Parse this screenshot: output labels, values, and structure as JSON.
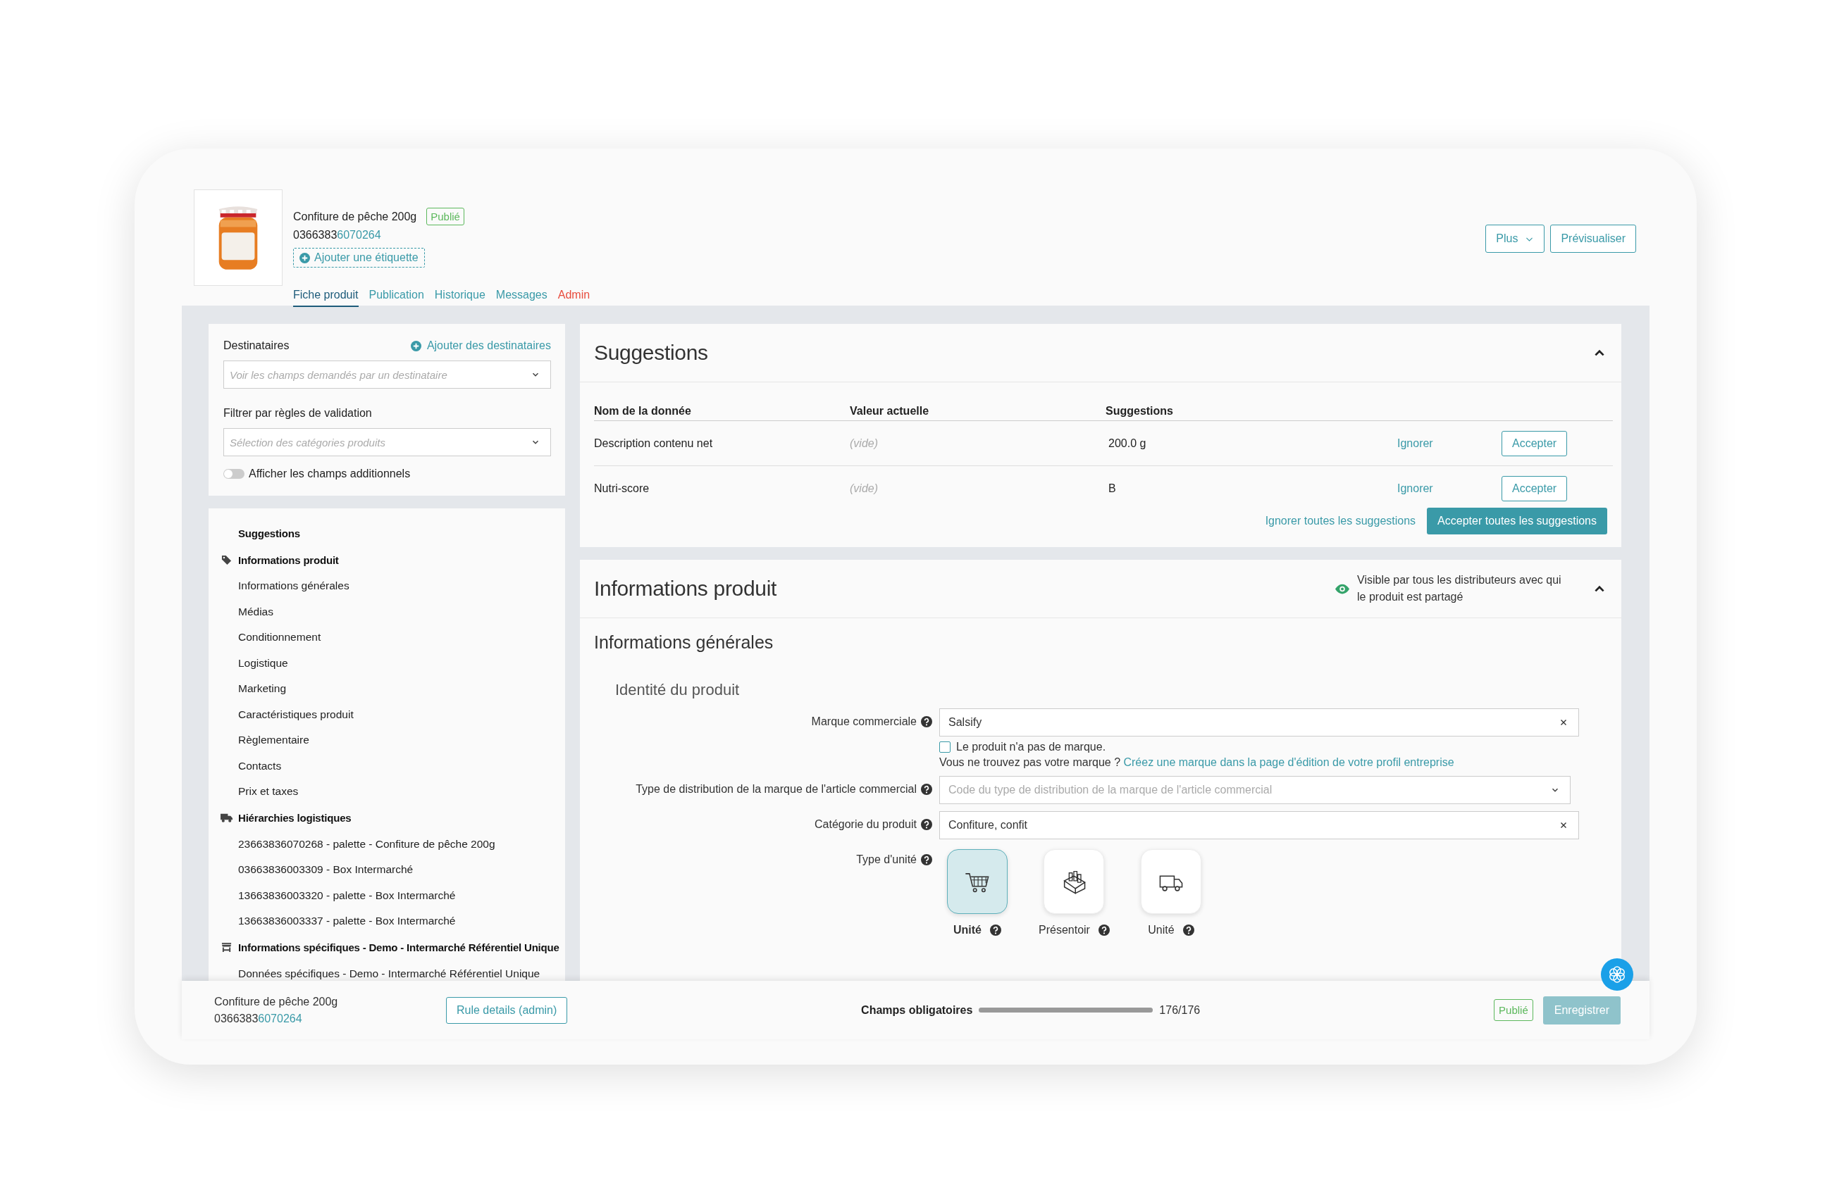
{
  "product": {
    "name": "Confiture de pêche 200g",
    "status": "Publié",
    "code_start": "0366383",
    "code_end": "6070264",
    "add_label": "Ajouter une étiquette"
  },
  "header_buttons": [
    {
      "label": "Plus",
      "kind": "dropdown"
    },
    {
      "label": "Prévisualiser",
      "kind": "plain"
    }
  ],
  "tabs": [
    {
      "label": "Fiche produit",
      "selected": true,
      "kind": "normal"
    },
    {
      "label": "Publication",
      "selected": false,
      "kind": "normal"
    },
    {
      "label": "Historique",
      "selected": false,
      "kind": "normal"
    },
    {
      "label": "Messages",
      "selected": false,
      "kind": "normal"
    },
    {
      "label": "Admin",
      "selected": false,
      "kind": "admin"
    }
  ],
  "filters": {
    "recipients_label": "Destinataires",
    "add_recipients": "Ajouter des destinataires",
    "recipients_placeholder": "Voir les champs demandés par un destinataire",
    "rules_label": "Filtrer par règles de validation",
    "rules_placeholder": "Sélection des catégories produits",
    "toggle": {
      "label": "Afficher les champs additionnels",
      "on": false
    }
  },
  "nav": [
    {
      "label": "Suggestions",
      "kind": "link"
    },
    {
      "label": "Informations produit",
      "kind": "product",
      "children": [
        {
          "label": "Informations générales"
        },
        {
          "label": "Médias"
        },
        {
          "label": "Conditionnement"
        },
        {
          "label": "Logistique"
        },
        {
          "label": "Marketing"
        },
        {
          "label": "Caractéristiques produit"
        },
        {
          "label": "Règlementaire"
        },
        {
          "label": "Contacts"
        },
        {
          "label": "Prix et taxes"
        }
      ]
    },
    {
      "label": "Hiérarchies logistiques",
      "kind": "logistics",
      "children": [
        {
          "label": "23663836070268 - palette - Confiture de pêche 200g"
        },
        {
          "label": "03663836003309 - Box Intermarché"
        },
        {
          "label": "13663836003320 - palette - Box Intermarché"
        },
        {
          "label": "13663836003337 - palette - Box Intermarché"
        }
      ]
    },
    {
      "label": "Informations spécifiques - Demo - Intermarché Référentiel Unique",
      "kind": "retailer",
      "children": [
        {
          "label": "Données spécifiques - Demo - Intermarché Référentiel Unique"
        }
      ]
    }
  ],
  "suggestions": {
    "title": "Suggestions",
    "expanded": true,
    "columns": [
      "Nom de la donnée",
      "Valeur actuelle",
      "Suggestions"
    ],
    "rows": [
      {
        "name": "Description contenu net",
        "current": "(vide)",
        "suggestion": "200.0 g",
        "ignore": "Ignorer",
        "accept": "Accepter"
      },
      {
        "name": "Nutri-score",
        "current": "(vide)",
        "suggestion": "B",
        "ignore": "Ignorer",
        "accept": "Accepter"
      }
    ],
    "ignore_all": "Ignorer toutes les suggestions",
    "accept_all": "Accepter toutes les suggestions"
  },
  "product_info": {
    "title": "Informations produit",
    "expanded": true,
    "visibility": "Visible par tous les distributeurs avec qui le produit est partagé",
    "section": "Informations générales",
    "subsection": "Identité du produit",
    "fields": [
      {
        "kind": "text",
        "label": "Marque commerciale",
        "value": "Salsify"
      },
      {
        "kind": "checkbox",
        "label": "Le produit n'a pas de marque.",
        "checked": false
      },
      {
        "kind": "note",
        "text": "Vous ne trouvez pas votre marque ?",
        "link": "Créez une marque dans la page d'édition de votre profil entreprise"
      },
      {
        "kind": "select",
        "label": "Type de distribution de la marque de l'article commercial",
        "placeholder": "Code du type de distribution de la marque de l'article commercial"
      },
      {
        "kind": "text",
        "label": "Catégorie du produit",
        "value": "Confiture, confit"
      },
      {
        "kind": "units",
        "label": "Type d'unité",
        "options": [
          {
            "label": "Unité",
            "selected": true
          },
          {
            "label": "Présentoir",
            "selected": false
          },
          {
            "label": "Unité",
            "selected": false
          }
        ]
      }
    ]
  },
  "footer": {
    "name": "Confiture de pêche 200g",
    "code_start": "0366383",
    "code_end": "6070264",
    "rule_button": "Rule details (admin)",
    "progress_label": "Champs obligatoires",
    "level": 1,
    "progress_reading": "176/176",
    "status": "Publié",
    "save": "Enregistrer",
    "save_disabled": true
  }
}
